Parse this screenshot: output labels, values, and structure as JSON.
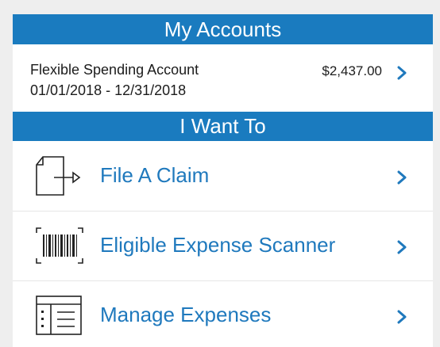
{
  "my_accounts": {
    "header": "My Accounts",
    "account": {
      "name": "Flexible Spending Account",
      "dates": "01/01/2018 - 12/31/2018",
      "balance": "$2,437.00"
    }
  },
  "i_want_to": {
    "header": "I Want To",
    "actions": [
      {
        "label": "File A Claim",
        "icon": "file-claim-icon"
      },
      {
        "label": "Eligible Expense Scanner",
        "icon": "barcode-scanner-icon"
      },
      {
        "label": "Manage Expenses",
        "icon": "expense-list-icon"
      }
    ]
  },
  "colors": {
    "header_bg": "#1a7bbf",
    "link": "#1f79bd",
    "chevron": "#1f79bd"
  }
}
